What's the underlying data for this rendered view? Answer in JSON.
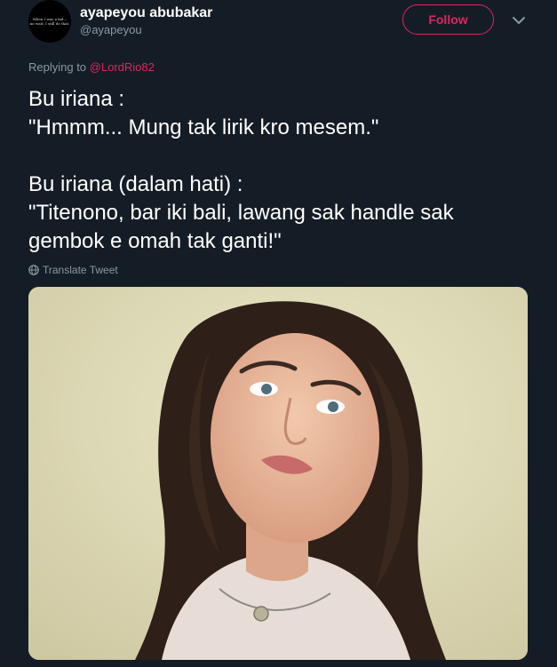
{
  "tweet": {
    "avatar": {
      "lines": [
        "When I was a kid...",
        "no wait, I still do that."
      ]
    },
    "author": {
      "display_name": "ayapeyou abubakar",
      "username": "@ayapeyou"
    },
    "follow_label": "Follow",
    "replying_prefix": "Replying to",
    "replying_handle": "@LordRio82",
    "text_lines": [
      "Bu iriana :",
      "\"Hmmm... Mung tak lirik kro mesem.\"",
      "",
      "Bu iriana (dalam hati) :",
      "\"Titenono, bar iki bali, lawang sak handle sak",
      "gembok e omah tak ganti!\""
    ],
    "translate_label": "Translate Tweet",
    "media": {
      "icon": "photo"
    }
  },
  "colors": {
    "background": "#141d26",
    "accent": "#e0245e",
    "secondary_text": "#8899a6",
    "primary_text": "#ffffff"
  }
}
